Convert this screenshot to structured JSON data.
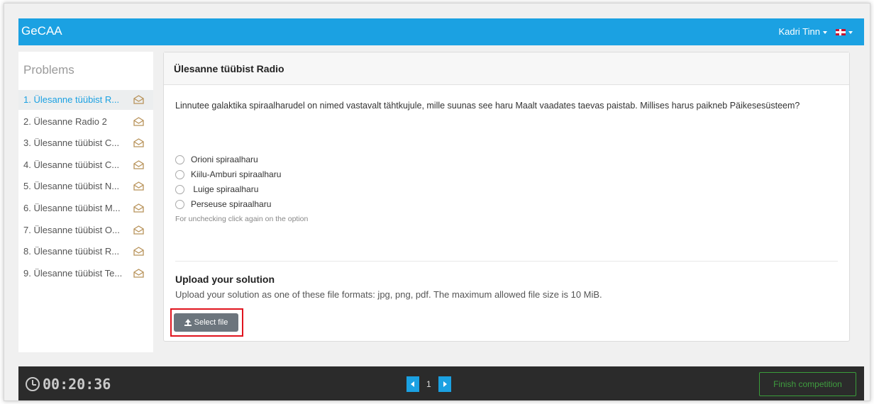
{
  "navbar": {
    "brand": "GeCAA",
    "user_name": "Kadri Tinn",
    "language_icon": "uk-flag-icon"
  },
  "sidebar": {
    "title": "Problems",
    "items": [
      {
        "label": "1. Ülesanne tüübist R...",
        "active": true
      },
      {
        "label": "2. Ülesanne Radio 2",
        "active": false
      },
      {
        "label": "3. Ülesanne tüübist C...",
        "active": false
      },
      {
        "label": "4. Ülesanne tüübist C...",
        "active": false
      },
      {
        "label": "5. Ülesanne tüübist N...",
        "active": false
      },
      {
        "label": "6. Ülesanne tüübist M...",
        "active": false
      },
      {
        "label": "7. Ülesanne tüübist O...",
        "active": false
      },
      {
        "label": "8. Ülesanne tüübist R...",
        "active": false
      },
      {
        "label": "9. Ülesanne tüübist Te...",
        "active": false
      }
    ],
    "item_icon": "envelope-open-icon"
  },
  "problem": {
    "title": "Ülesanne tüübist Radio",
    "question": "Linnutee galaktika spiraalharudel on nimed vastavalt tähtkujule, mille suunas see haru Maalt vaadates taevas paistab. Millises harus paikneb Päikesesüsteem?",
    "options": [
      "Orioni spiraalharu",
      "Kiilu-Amburi spiraalharu",
      " Luige spiraalharu",
      "Perseuse spiraalharu"
    ],
    "hint": "For unchecking click again on the option"
  },
  "upload": {
    "title": "Upload your solution",
    "description": "Upload your solution as one of these file formats: jpg, png, pdf. The maximum allowed file size is 10 MiB.",
    "button_label": "Select file"
  },
  "footer": {
    "timer": "00:20:36",
    "page_number": "1",
    "finish_label": "Finish competition"
  },
  "colors": {
    "navbar": "#1ba1e2",
    "footer": "#2b2b2b",
    "finish_border": "#3a9d3a",
    "highlight_box": "#e0141e"
  }
}
